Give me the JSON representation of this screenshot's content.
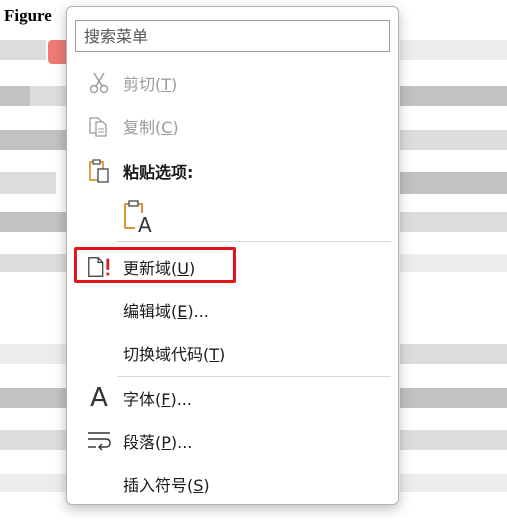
{
  "document": {
    "heading": "Figure"
  },
  "menu": {
    "search_placeholder": "搜索菜单",
    "items": [
      {
        "key": "cut",
        "text": "剪切(",
        "accel": "T",
        "tail": ")",
        "icon": "scissors-icon",
        "disabled": true
      },
      {
        "key": "copy",
        "text": "复制(",
        "accel": "C",
        "tail": ")",
        "icon": "copy-icon",
        "disabled": true
      },
      {
        "key": "paste-options",
        "text": "粘贴选项:",
        "icon": "clipboard-icon",
        "disabled": false
      },
      {
        "key": "update-field",
        "text": "更新域(",
        "accel": "U",
        "tail": ")",
        "icon": "update-field-icon",
        "disabled": false
      },
      {
        "key": "edit-field",
        "text": "编辑域(",
        "accel": "E",
        "tail": ")...",
        "disabled": false
      },
      {
        "key": "toggle-field-codes",
        "text": "切换域代码(",
        "accel": "T",
        "tail": ")",
        "disabled": false
      },
      {
        "key": "font",
        "text": "字体(",
        "accel": "F",
        "tail": ")...",
        "icon": "font-icon",
        "disabled": false
      },
      {
        "key": "paragraph",
        "text": "段落(",
        "accel": "P",
        "tail": ")...",
        "icon": "paragraph-icon",
        "disabled": false
      },
      {
        "key": "insert-symbol",
        "text": "插入符号(",
        "accel": "S",
        "tail": ")",
        "disabled": false
      }
    ],
    "paste_text_only_letter": "A"
  },
  "colors": {
    "highlight": "#e3151a",
    "clipboard_orange": "#d98b1c",
    "update_red": "#d61e1e"
  }
}
